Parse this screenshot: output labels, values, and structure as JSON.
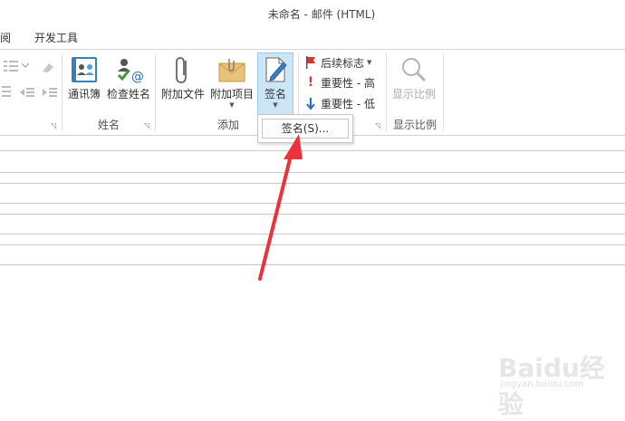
{
  "window": {
    "title": "未命名 - 邮件 (HTML)"
  },
  "tabs": [
    {
      "label": "阅"
    },
    {
      "label": "开发工具"
    }
  ],
  "ribbon": {
    "groups": [
      {
        "label": "姓名"
      },
      {
        "label": "添加"
      },
      {
        "label": "显示比例"
      }
    ],
    "buttons": {
      "address_book": "通讯簿",
      "check_names": "检查姓名",
      "attach_file": "附加文件",
      "attach_item": "附加项目",
      "signature": "签名",
      "follow_up": "后续标志",
      "importance_high": "重要性 - 高",
      "importance_low": "重要性 - 低",
      "zoom": "显示比例"
    }
  },
  "signature_menu": {
    "items": [
      {
        "label": "签名(S)..."
      }
    ]
  },
  "watermark": {
    "text": "Baidu经验",
    "url": "jingyan.baidu.com"
  },
  "colors": {
    "accent_selected": "#cde6f7",
    "arrow": "#e8333a"
  }
}
